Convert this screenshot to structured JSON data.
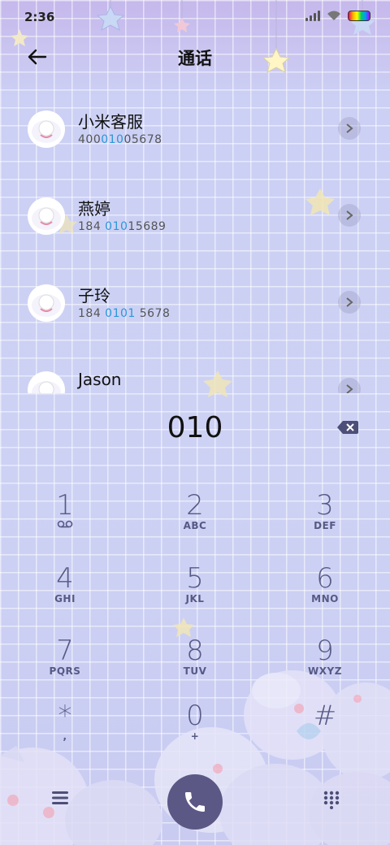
{
  "status_bar": {
    "time": "2:36"
  },
  "header": {
    "title": "通话"
  },
  "contacts": [
    {
      "name": "小米客服",
      "number_parts": [
        "400",
        "010",
        "05678"
      ]
    },
    {
      "name": "燕婷",
      "number_parts": [
        "184 ",
        "010",
        "15689"
      ]
    },
    {
      "name": "子玲",
      "number_parts": [
        "184 ",
        "0101",
        " 5678"
      ]
    },
    {
      "name": "Jason",
      "number_parts": [
        "",
        "",
        ""
      ]
    }
  ],
  "input": {
    "digits": "010"
  },
  "keypad": [
    {
      "digit": "1",
      "letters": ""
    },
    {
      "digit": "2",
      "letters": "ABC"
    },
    {
      "digit": "3",
      "letters": "DEF"
    },
    {
      "digit": "4",
      "letters": "GHI"
    },
    {
      "digit": "5",
      "letters": "JKL"
    },
    {
      "digit": "6",
      "letters": "MNO"
    },
    {
      "digit": "7",
      "letters": "PQRS"
    },
    {
      "digit": "8",
      "letters": "TUV"
    },
    {
      "digit": "9",
      "letters": "WXYZ"
    },
    {
      "digit": "*",
      "letters": ","
    },
    {
      "digit": "0",
      "letters": "+"
    },
    {
      "digit": "#",
      "letters": ""
    }
  ],
  "colors": {
    "accent_highlight": "#2b97d9",
    "call_button": "#5c5886",
    "keypad_text": "#565985"
  },
  "icons": {
    "back": "arrow-left-icon",
    "voicemail": "voicemail-icon",
    "backspace": "backspace-icon",
    "menu": "menu-icon",
    "call": "phone-icon",
    "dialpad": "dialpad-icon"
  }
}
